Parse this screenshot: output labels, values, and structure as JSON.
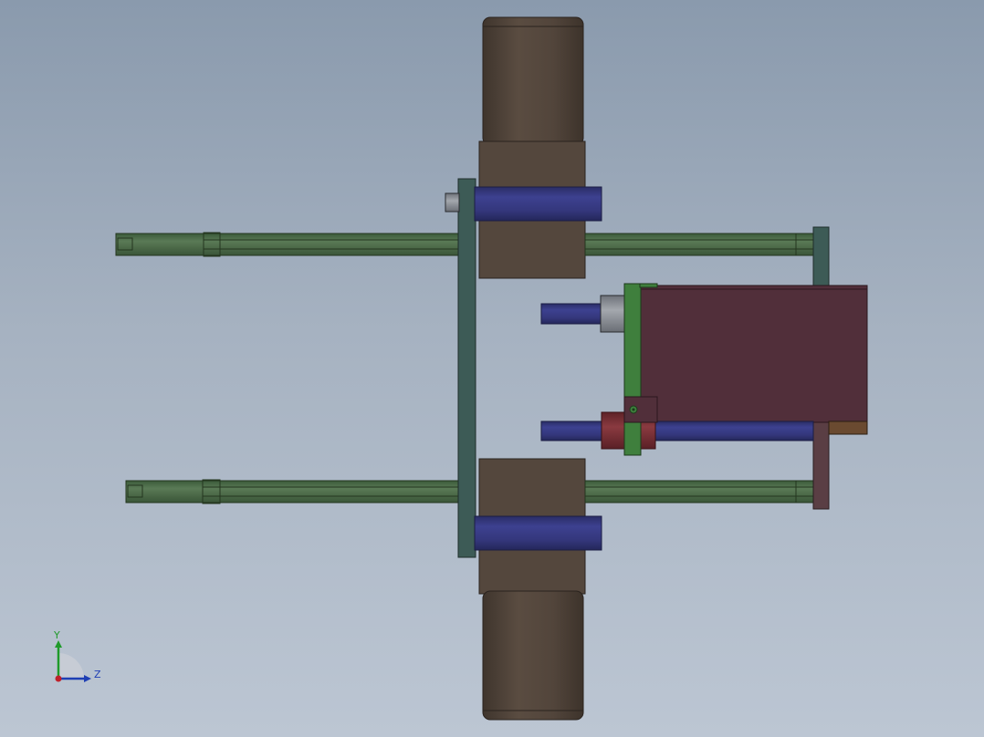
{
  "viewport": {
    "background_top": "#8a9aad",
    "background_bottom": "#bcc6d3"
  },
  "triad": {
    "y_label": "Y",
    "z_label": "Z",
    "y_color": "#1f9a2a",
    "z_color": "#1f3fb4",
    "x_color": "#c0202a"
  },
  "colors": {
    "roller": "#53463d",
    "roller_light": "#6a5c50",
    "rod": "#4b6a4a",
    "rod_light": "#6a8a66",
    "plate": "#3d5b56",
    "shaft": "#35387a",
    "shaft_light": "#5558a8",
    "motor": "#512f3a",
    "motor_top": "#6b4450",
    "green_plate": "#3f7f3d",
    "gray_part": "#8a8e95",
    "red_part": "#7a2f34",
    "brown_tab": "#6a4a30"
  }
}
